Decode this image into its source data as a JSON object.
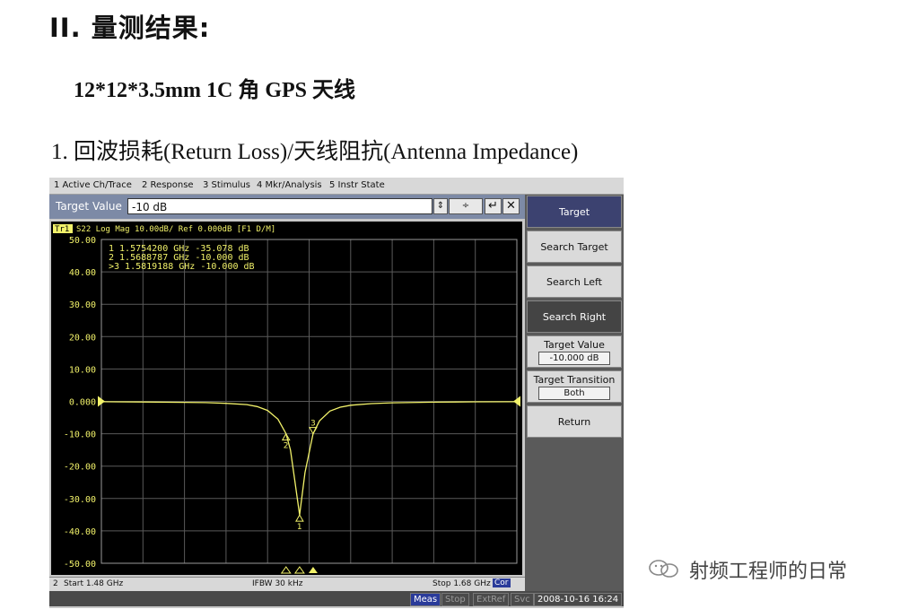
{
  "doc": {
    "heading": "II. 量测结果:",
    "subheading": "12*12*3.5mm 1C 角 GPS  天线",
    "section": "1. 回波损耗(Return Loss)/天线阻抗(Antenna Impedance)"
  },
  "menu": [
    "1 Active Ch/Trace",
    "2 Response",
    "3 Stimulus",
    "4 Mkr/Analysis",
    "5 Instr State"
  ],
  "entry": {
    "label": "Target Value",
    "value": "-10 dB"
  },
  "trace_header": {
    "tag": "Tr1",
    "text": "S22 Log Mag 10.00dB/ Ref 0.000dB [F1 D/M]"
  },
  "markers": [
    {
      "line": "1  1.5754200 GHz -35.078 dB"
    },
    {
      "line": "2  1.5688787 GHz -10.000 dB"
    },
    {
      "line": ">3  1.5819188 GHz -10.000 dB"
    }
  ],
  "softkeys": {
    "title": "Target",
    "search_target": "Search Target",
    "search_left": "Search Left",
    "search_right": "Search Right",
    "target_value_label": "Target Value",
    "target_value": "-10.000 dB",
    "target_transition_label": "Target Transition",
    "target_transition": "Both",
    "return": "Return"
  },
  "status": {
    "channel": "2",
    "start": "Start 1.48 GHz",
    "ifbw": "IFBW 30 kHz",
    "stop": "Stop 1.68 GHz",
    "cor": "Cor",
    "meas": "Meas",
    "stop_btn": "Stop",
    "extref": "ExtRef",
    "svc": "Svc",
    "datetime": "2008-10-16 16:24"
  },
  "watermark": "射频工程师的日常",
  "chart_data": {
    "type": "line",
    "title": "S22 Log Mag 10.00dB/ Ref 0.000dB [F1 D/M]",
    "ylim": [
      -50,
      50
    ],
    "xlim": [
      1.48,
      1.68
    ],
    "yticks": [
      "50.00",
      "40.00",
      "30.00",
      "20.00",
      "10.00",
      "0.000",
      "-10.00",
      "-20.00",
      "-30.00",
      "-40.00",
      "-50.00"
    ],
    "grid": true,
    "trace_color": "#f2f26a",
    "series": [
      {
        "x": [
          1.48,
          1.5,
          1.52,
          1.53,
          1.54,
          1.55,
          1.555,
          1.56,
          1.565,
          1.5689,
          1.571,
          1.573,
          1.5754,
          1.578,
          1.5819,
          1.585,
          1.59,
          1.595,
          1.6,
          1.61,
          1.62,
          1.64,
          1.66,
          1.68
        ],
        "values": [
          -0.1,
          -0.2,
          -0.3,
          -0.4,
          -0.6,
          -1.0,
          -1.6,
          -2.8,
          -5.5,
          -10.0,
          -15.0,
          -24.0,
          -35.078,
          -22.0,
          -10.0,
          -6.0,
          -3.0,
          -1.8,
          -1.2,
          -0.7,
          -0.45,
          -0.25,
          -0.15,
          -0.1
        ]
      }
    ]
  }
}
